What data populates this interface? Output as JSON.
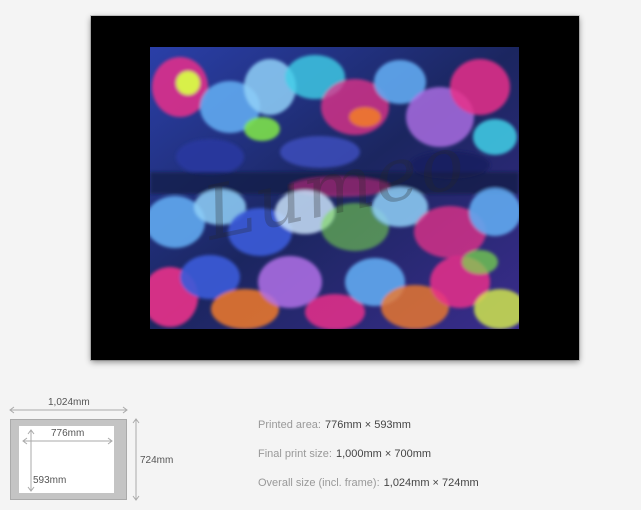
{
  "artwork": {
    "watermark_text": "Lumeo",
    "colors": {
      "frame": "#000000",
      "background": "#f4f4f4",
      "art_blue": "#3a5bd9",
      "art_pink": "#e8308a",
      "art_green": "#7be04a",
      "art_cyan": "#3fd0e8",
      "art_orange": "#f07a2a"
    }
  },
  "diagram": {
    "width_label": "1,024mm",
    "height_label": "724mm",
    "inner_width_label": "776mm",
    "inner_height_label": "593mm"
  },
  "info": {
    "printed_area_label": "Printed area:",
    "printed_area_value": "776mm × 593mm",
    "final_print_label": "Final print size:",
    "final_print_value": "1,000mm × 700mm",
    "overall_label": "Overall size (incl. frame):",
    "overall_value": "1,024mm × 724mm"
  }
}
